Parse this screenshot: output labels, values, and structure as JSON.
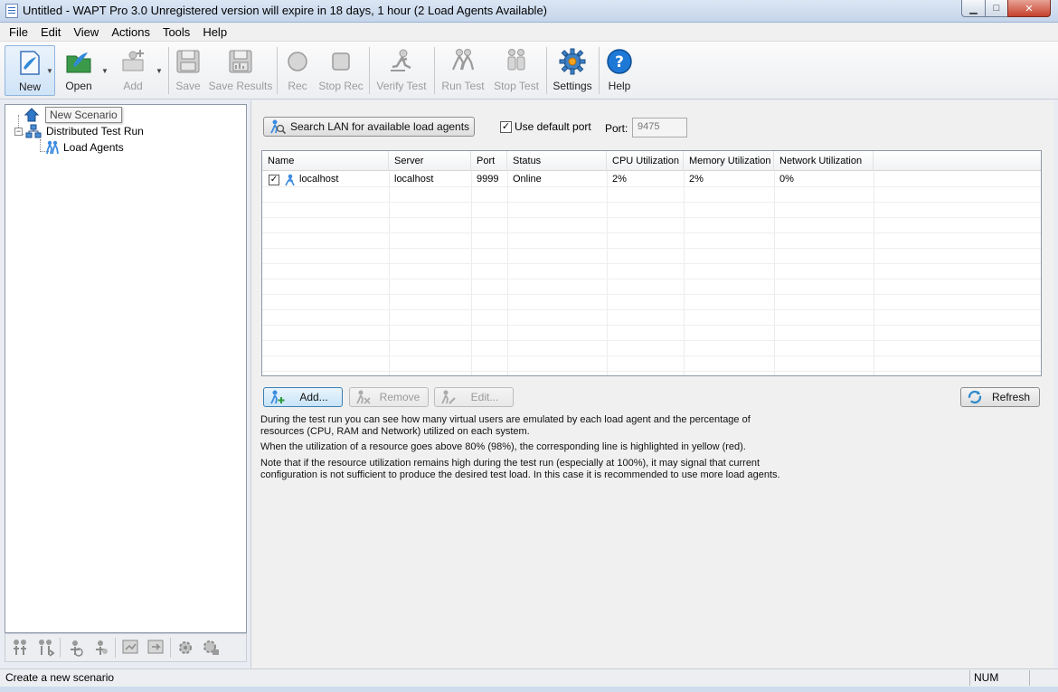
{
  "window": {
    "title": "Untitled - WAPT Pro 3.0 Unregistered version will expire in 18 days, 1 hour (2 Load Agents Available)",
    "min_glyph": "▁",
    "max_glyph": "□",
    "close_glyph": "✕"
  },
  "menu": [
    "File",
    "Edit",
    "View",
    "Actions",
    "Tools",
    "Help"
  ],
  "toolbar": {
    "new": "New",
    "open": "Open",
    "add": "Add",
    "save": "Save",
    "save_results": "Save Results",
    "rec": "Rec",
    "stop_rec": "Stop Rec",
    "verify_test": "Verify Test",
    "run_test": "Run Test",
    "stop_test": "Stop Test",
    "settings": "Settings",
    "help": "Help"
  },
  "tree": {
    "tooltip": "New Scenario",
    "distributed": "Distributed Test Run",
    "load_agents": "Load Agents"
  },
  "search_button": "Search LAN for available load agents",
  "use_default_port": "Use default port",
  "port_label": "Port:",
  "port_value": "9475",
  "grid": {
    "headers": [
      "Name",
      "Server",
      "Port",
      "Status",
      "CPU Utilization",
      "Memory Utilization",
      "Network Utilization"
    ],
    "rows": [
      {
        "name": "localhost",
        "server": "localhost",
        "port": "9999",
        "status": "Online",
        "cpu": "2%",
        "memory": "2%",
        "network": "0%"
      }
    ]
  },
  "buttons": {
    "add": "Add...",
    "remove": "Remove",
    "edit": "Edit...",
    "refresh": "Refresh"
  },
  "info": {
    "p1": "During the test run you can see how many virtual users are emulated by each load agent and the percentage of resources (CPU, RAM and Network) utilized on each system.",
    "p2": "When the utilization of a resource goes above 80% (98%), the corresponding line is highlighted in yellow (red).",
    "p3": "Note that if the resource utilization remains high during the test run (especially at 100%), it may signal that current configuration is not sufficient to produce the desired test load. In this case it is recommended to use more load agents."
  },
  "status": {
    "text": "Create a new scenario",
    "num": "NUM"
  }
}
